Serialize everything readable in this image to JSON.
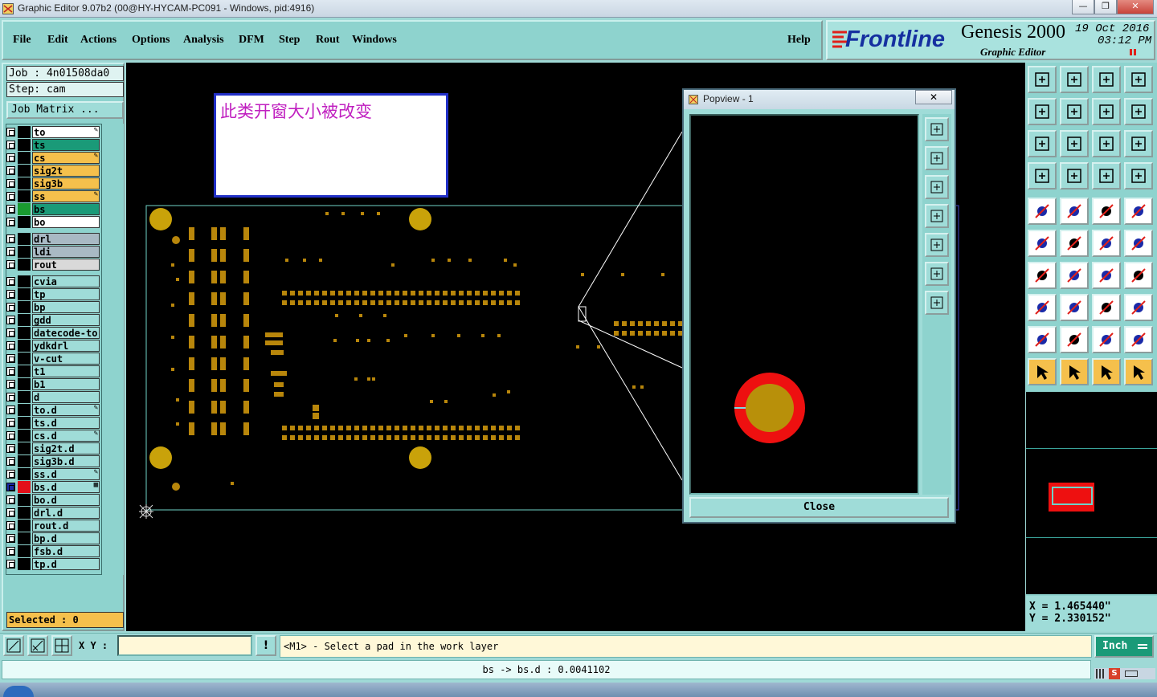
{
  "window": {
    "title": "Graphic Editor 9.07b2 (00@HY-HYCAM-PC091 - Windows, pid:4916)",
    "min": "—",
    "max": "❐",
    "close": "✕"
  },
  "menu": {
    "items": [
      "File",
      "Edit",
      "Actions",
      "Options",
      "Analysis",
      "DFM",
      "Step",
      "Rout",
      "Windows"
    ],
    "help": "Help"
  },
  "brand": {
    "logo": "Frontline",
    "product": "Genesis 2000",
    "subtitle": "Graphic Editor",
    "date": "19 Oct 2016",
    "time": "03:12 PM"
  },
  "job": {
    "job_label": "Job : 4n01508da0",
    "step_label": "Step: cam",
    "matrix_button": "Job Matrix ..."
  },
  "layers": [
    {
      "name": "to",
      "color": "#ffffff",
      "swatch": "#000000",
      "icon": "✎"
    },
    {
      "name": "ts",
      "color": "#1a9a78",
      "swatch": "#000000",
      "icon": ""
    },
    {
      "name": "cs",
      "color": "#f5c04c",
      "swatch": "#000000",
      "icon": "✎"
    },
    {
      "name": "sig2t",
      "color": "#f5c04c",
      "swatch": "#000000",
      "icon": ""
    },
    {
      "name": "sig3b",
      "color": "#f5c04c",
      "swatch": "#000000",
      "icon": ""
    },
    {
      "name": "ss",
      "color": "#f5c04c",
      "swatch": "#000000",
      "icon": "✎"
    },
    {
      "name": "bs",
      "color": "#1a9a78",
      "swatch": "#1a9a30",
      "icon": ""
    },
    {
      "name": "bo",
      "color": "#ffffff",
      "swatch": "#000000",
      "icon": ""
    },
    {
      "name": "drl",
      "color": "#a9b9c4",
      "swatch": "#000000",
      "icon": ""
    },
    {
      "name": "ldi",
      "color": "#a9b9c4",
      "swatch": "#000000",
      "icon": ""
    },
    {
      "name": "rout",
      "color": "#d9d9d9",
      "swatch": "#000000",
      "icon": ""
    },
    {
      "name": "cvia",
      "color": "#9fdcd8",
      "swatch": "#000000",
      "icon": ""
    },
    {
      "name": "tp",
      "color": "#9fdcd8",
      "swatch": "#000000",
      "icon": ""
    },
    {
      "name": "bp",
      "color": "#9fdcd8",
      "swatch": "#000000",
      "icon": ""
    },
    {
      "name": "gdd",
      "color": "#9fdcd8",
      "swatch": "#000000",
      "icon": ""
    },
    {
      "name": "datecode-to",
      "color": "#9fdcd8",
      "swatch": "#000000",
      "icon": ""
    },
    {
      "name": "ydkdrl",
      "color": "#9fdcd8",
      "swatch": "#000000",
      "icon": ""
    },
    {
      "name": "v-cut",
      "color": "#9fdcd8",
      "swatch": "#000000",
      "icon": ""
    },
    {
      "name": "t1",
      "color": "#9fdcd8",
      "swatch": "#000000",
      "icon": ""
    },
    {
      "name": "b1",
      "color": "#9fdcd8",
      "swatch": "#000000",
      "icon": ""
    },
    {
      "name": "d",
      "color": "#9fdcd8",
      "swatch": "#000000",
      "icon": ""
    },
    {
      "name": "to.d",
      "color": "#9fdcd8",
      "swatch": "#000000",
      "icon": "✎"
    },
    {
      "name": "ts.d",
      "color": "#9fdcd8",
      "swatch": "#000000",
      "icon": ""
    },
    {
      "name": "cs.d",
      "color": "#9fdcd8",
      "swatch": "#000000",
      "icon": "✎"
    },
    {
      "name": "sig2t.d",
      "color": "#9fdcd8",
      "swatch": "#000000",
      "icon": ""
    },
    {
      "name": "sig3b.d",
      "color": "#9fdcd8",
      "swatch": "#000000",
      "icon": ""
    },
    {
      "name": "ss.d",
      "color": "#9fdcd8",
      "swatch": "#000000",
      "icon": "✎"
    },
    {
      "name": "bs.d",
      "color": "#9fdcd8",
      "swatch": "#e3101a",
      "icon": "▦"
    },
    {
      "name": "bo.d",
      "color": "#9fdcd8",
      "swatch": "#000000",
      "icon": ""
    },
    {
      "name": "drl.d",
      "color": "#9fdcd8",
      "swatch": "#000000",
      "icon": ""
    },
    {
      "name": "rout.d",
      "color": "#9fdcd8",
      "swatch": "#000000",
      "icon": ""
    },
    {
      "name": "bp.d",
      "color": "#9fdcd8",
      "swatch": "#000000",
      "icon": ""
    },
    {
      "name": "fsb.d",
      "color": "#9fdcd8",
      "swatch": "#000000",
      "icon": ""
    },
    {
      "name": "tp.d",
      "color": "#9fdcd8",
      "swatch": "#000000",
      "icon": ""
    }
  ],
  "selected": "Selected : 0",
  "annotation": "此类开窗大小被改变",
  "popview": {
    "title": "Popview - 1",
    "close_x": "✕",
    "close_button": "Close"
  },
  "coords": {
    "x": "X = 1.465440\"",
    "y": "Y = 2.330152\""
  },
  "status": {
    "xy_label": "X Y :",
    "xy_value": "",
    "warn": "!",
    "prompt": "<M1> - Select a pad in the work layer",
    "units": "Inch"
  },
  "bottom": {
    "message": "bs -> bs.d : 0.0041102"
  },
  "tools": [
    "home",
    "screen-fit",
    "group",
    "split",
    "prev",
    "next",
    "mirror",
    "s-shape",
    "fit",
    "center",
    "ratio-1-2",
    "help",
    "filter",
    "grid",
    "snap-a",
    "snap-b",
    "pad",
    "edit",
    "ruler",
    "dot",
    "connect",
    "cross",
    "measure-a",
    "measure-b",
    "angle",
    "line",
    "rotate",
    "flip",
    "select-area",
    "cut",
    "dimension",
    "copy",
    "tri-a",
    "tri-b",
    "tri-c",
    "tri-d",
    "pointer",
    "pointer-box",
    "pointer-circle",
    "pointer-net"
  ]
}
